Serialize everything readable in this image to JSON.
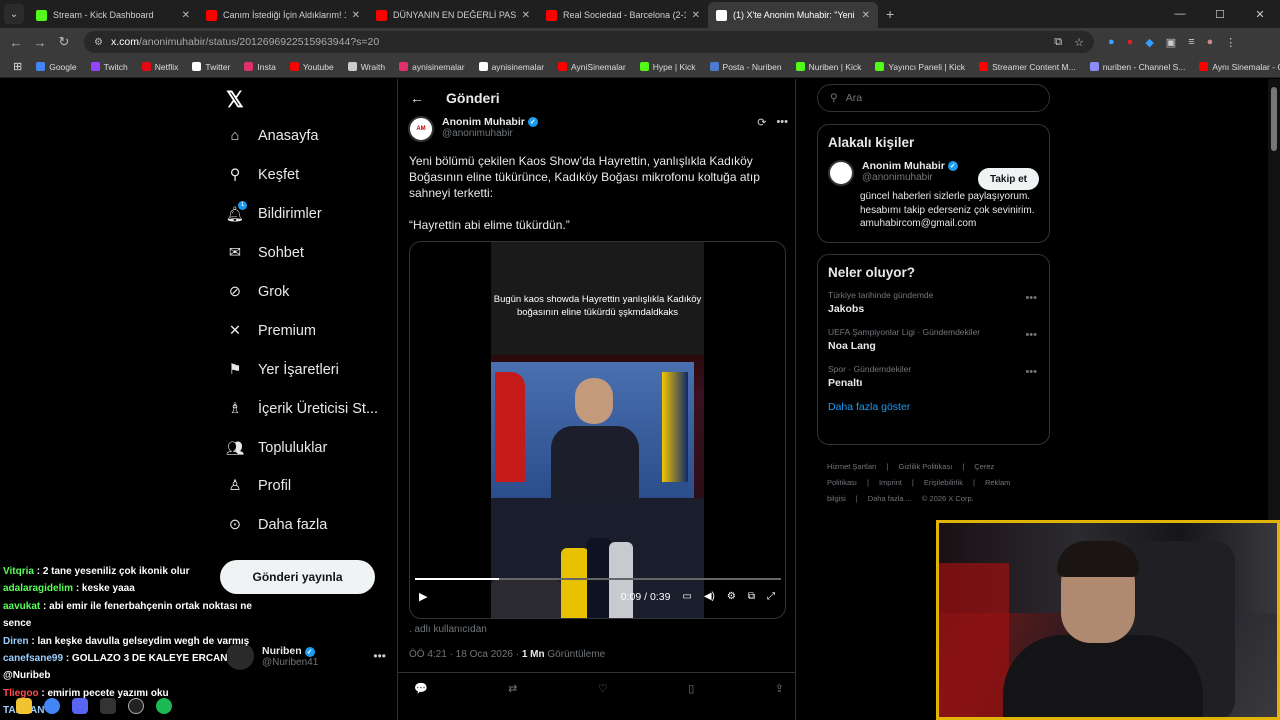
{
  "browser": {
    "tabs": [
      {
        "label": "Stream - Kick Dashboard",
        "color": "#53fc18"
      },
      {
        "label": "Canım İstediği İçin Aldıklarım! 1",
        "color": "#ff0000"
      },
      {
        "label": "DÜNYANIN EN DEĞERLİ PASPAS",
        "color": "#ff0000"
      },
      {
        "label": "Real Sociedad - Barcelona (2-1)",
        "color": "#ff0000"
      },
      {
        "label": "(1) X'te Anonim Muhabir: \"Yeni",
        "color": "#ffffff"
      }
    ],
    "url_domain": "x.com",
    "url_path": "/anonimuhabir/status/2012696922515963944?s=20",
    "bookmarks": [
      {
        "label": "Google",
        "color": "#4285f4"
      },
      {
        "label": "Twitch",
        "color": "#9146ff"
      },
      {
        "label": "Netflix",
        "color": "#e50914"
      },
      {
        "label": "Twitter",
        "color": "#ffffff"
      },
      {
        "label": "Insta",
        "color": "#e1306c"
      },
      {
        "label": "Youtube",
        "color": "#ff0000"
      },
      {
        "label": "Wraith",
        "color": "#cccccc"
      },
      {
        "label": "aynisinemalar",
        "color": "#e1306c"
      },
      {
        "label": "aynisinemalar",
        "color": "#ffffff"
      },
      {
        "label": "AyniSinemalar",
        "color": "#ff0000"
      },
      {
        "label": "Hype | Kick",
        "color": "#53fc18"
      },
      {
        "label": "Posta - Nuriben",
        "color": "#4a7bd0"
      },
      {
        "label": "Nuriben | Kick",
        "color": "#53fc18"
      },
      {
        "label": "Yayıncı Paneli | Kick",
        "color": "#53fc18"
      },
      {
        "label": "Streamer Content M...",
        "color": "#ff0000"
      },
      {
        "label": "nuriben - Channel S...",
        "color": "#8c8cff"
      },
      {
        "label": "Aynı Sinemalar - Ça...",
        "color": "#ff0000"
      }
    ]
  },
  "nav": {
    "items": [
      {
        "label": "Anasayfa",
        "icon": "home-icon"
      },
      {
        "label": "Keşfet",
        "icon": "search-icon"
      },
      {
        "label": "Bildirimler",
        "icon": "bell-icon",
        "badge": "1"
      },
      {
        "label": "Sohbet",
        "icon": "mail-icon"
      },
      {
        "label": "Grok",
        "icon": "grok-icon"
      },
      {
        "label": "Premium",
        "icon": "x-icon"
      },
      {
        "label": "Yer İşaretleri",
        "icon": "bookmark-icon"
      },
      {
        "label": "İçerik Üreticisi St...",
        "icon": "creator-icon"
      },
      {
        "label": "Topluluklar",
        "icon": "communities-icon"
      },
      {
        "label": "Profil",
        "icon": "profile-icon"
      },
      {
        "label": "Daha fazla",
        "icon": "more-icon"
      }
    ],
    "post_button": "Gönderi yayınla",
    "me": {
      "name": "Nuriben",
      "handle": "@Nuriben41"
    }
  },
  "post": {
    "header": "Gönderi",
    "author_name": "Anonim Muhabir",
    "author_handle": "@anonimuhabir",
    "paragraph1": "Yeni bölümü çekilen Kaos Show’da Hayrettin, yanlışlıkla Kadıköy Boğasının eline tükürünce, Kadıköy Boğası mikrofonu koltuğa atıp sahneyi terketti:",
    "paragraph2": "“Hayrettin abi elime tükürdün.”",
    "video_caption": "Bugün kaos showda Hayrettin yanlışlıkla Kadıköy boğasının eline tükürdü şşkmdaldkaks",
    "video_time": "0:09 / 0:39",
    "video_progress": 0.23,
    "note": ". adlı kullanıcıdan",
    "time": "ÖÖ 4:21 · 18 Oca 2026 · ",
    "views_count": "1 Mn",
    "views_label": " Görüntüleme"
  },
  "right": {
    "search_placeholder": "Ara",
    "related_title": "Alakalı kişiler",
    "related": {
      "name": "Anonim Muhabir",
      "handle": "@anonimuhabir",
      "follow": "Takip et",
      "bio": "güncel haberleri sizlerle paylaşıyorum. hesabımı takip ederseniz çok sevinirim. amuhabircom@gmail.com"
    },
    "trends_title": "Neler oluyor?",
    "trends": [
      {
        "context": "Türkiye tarihinde gündemde",
        "topic": "Jakobs"
      },
      {
        "context": "UEFA Şampiyonlar Ligi · Gündemdekiler",
        "topic": "Noa Lang"
      },
      {
        "context": "Spor · Gündemdekiler",
        "topic": "Penaltı"
      }
    ],
    "show_more": "Daha fazla göster",
    "footer_links": [
      "Hizmet Şartları",
      "|",
      "Gizlilik Politikası",
      "|",
      "Çerez Politikası",
      "|",
      "Imprint",
      "|",
      "Erişilebilirlik",
      "|",
      "Reklam bilgisi",
      "|",
      "Daha fazla ...",
      "© 2026 X Corp."
    ]
  },
  "chat": [
    {
      "user": "Vitqria",
      "msg": ": 2 tane yeseniliz çok ikonik olur",
      "cls": "u"
    },
    {
      "user": "adalaragidelim",
      "msg": ": keske yaaa",
      "cls": "u"
    },
    {
      "user": "aavukat",
      "msg": ": abi emir ile fenerbahçenin ortak noktası ne sence",
      "cls": "u"
    },
    {
      "user": "Diren",
      "msg": ": lan keşke davulla gelseydim wegh de varmış",
      "cls": "u2"
    },
    {
      "user": "canefsane99",
      "msg": ": GOLLAZO 3 DE KALEYE ERCAN @Nuribeb",
      "cls": "u2"
    },
    {
      "user": "Tliegoo",
      "msg": ": emirim pecete yazımı oku",
      "cls": "u3"
    },
    {
      "user": "TARHAN",
      "msg": ":",
      "cls": "u2"
    }
  ]
}
